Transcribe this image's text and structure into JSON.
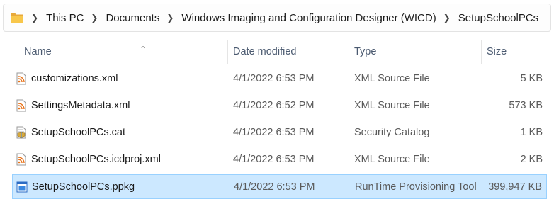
{
  "breadcrumb": {
    "items": [
      "This PC",
      "Documents",
      "Windows Imaging and Configuration Designer (WICD)",
      "SetupSchoolPCs"
    ]
  },
  "columns": {
    "name": "Name",
    "date": "Date modified",
    "type": "Type",
    "size": "Size"
  },
  "files": [
    {
      "name": "customizations.xml",
      "date": "4/1/2022 6:53 PM",
      "type": "XML Source File",
      "size": "5 KB",
      "icon": "xml-file-icon"
    },
    {
      "name": "SettingsMetadata.xml",
      "date": "4/1/2022 6:52 PM",
      "type": "XML Source File",
      "size": "573 KB",
      "icon": "xml-file-icon"
    },
    {
      "name": "SetupSchoolPCs.cat",
      "date": "4/1/2022 6:53 PM",
      "type": "Security Catalog",
      "size": "1 KB",
      "icon": "security-catalog-icon"
    },
    {
      "name": "SetupSchoolPCs.icdproj.xml",
      "date": "4/1/2022 6:53 PM",
      "type": "XML Source File",
      "size": "2 KB",
      "icon": "xml-file-icon"
    },
    {
      "name": "SetupSchoolPCs.ppkg",
      "date": "4/1/2022 6:53 PM",
      "type": "RunTime Provisioning Tool",
      "size": "399,947 KB",
      "icon": "ppkg-file-icon",
      "selected": true
    }
  ],
  "colors": {
    "selection_bg": "#cce8ff",
    "selection_border": "#99d1ff",
    "header_text": "#4b5a70",
    "folder": "#f8c74b"
  }
}
